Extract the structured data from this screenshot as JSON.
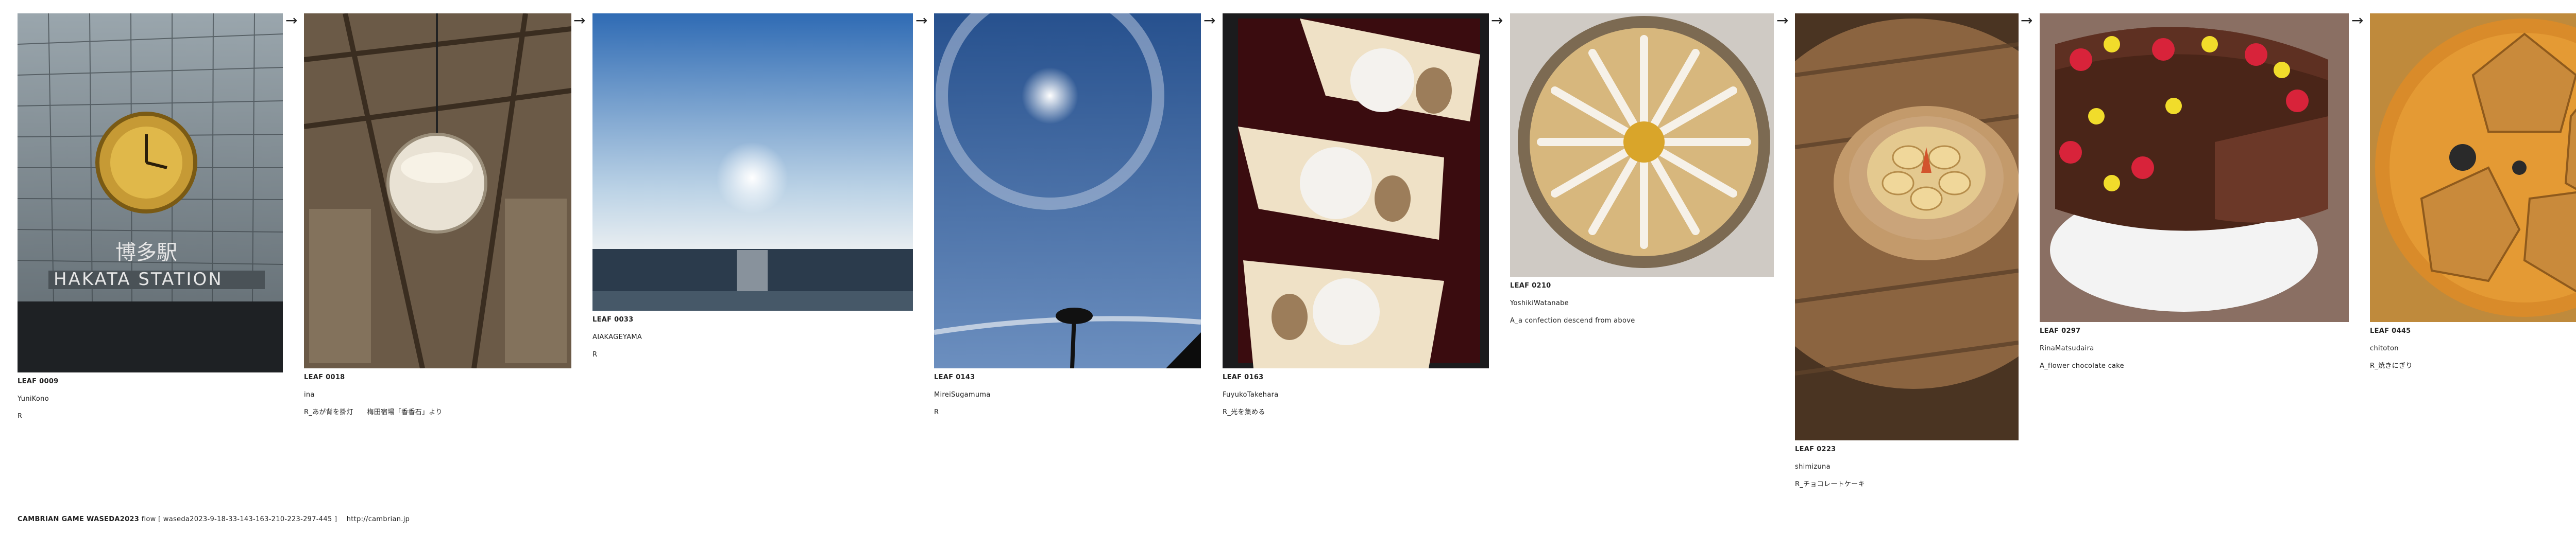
{
  "arrow_glyph": "→",
  "leaves": [
    {
      "id": "LEAF 0009",
      "author": "YuniKono",
      "caption": "R"
    },
    {
      "id": "LEAF 0018",
      "author": "ina",
      "caption": "R_あが背を掛灯　　梅田宿場「香香石」より"
    },
    {
      "id": "LEAF 0033",
      "author": "AIAKAGEYAMA",
      "caption": "R"
    },
    {
      "id": "LEAF 0143",
      "author": "MireiSugamuma",
      "caption": "R"
    },
    {
      "id": "LEAF 0163",
      "author": "FuyukoTakehara",
      "caption": "R_光を集める"
    },
    {
      "id": "LEAF 0210",
      "author": "YoshikiWatanabe",
      "caption": "A_a confection descend from above"
    },
    {
      "id": "LEAF 0223",
      "author": "shimizuna",
      "caption": "R_チョコレートケーキ"
    },
    {
      "id": "LEAF 0297",
      "author": "RinaMatsudaira",
      "caption": "A_flower chocolate cake"
    },
    {
      "id": "LEAF 0445",
      "author": "chitoton",
      "caption": "R_焼きにぎり"
    }
  ],
  "photo_texts": {
    "station_sign_jp": "博多駅",
    "station_sign_en": "HAKATA STATION"
  },
  "footer": {
    "title": "CAMBRIAN GAME  WASEDA2023",
    "flow": "flow [ waseda2023-9-18-33-143-163-210-223-297-445 ]",
    "url": "http://cambrian.jp"
  }
}
